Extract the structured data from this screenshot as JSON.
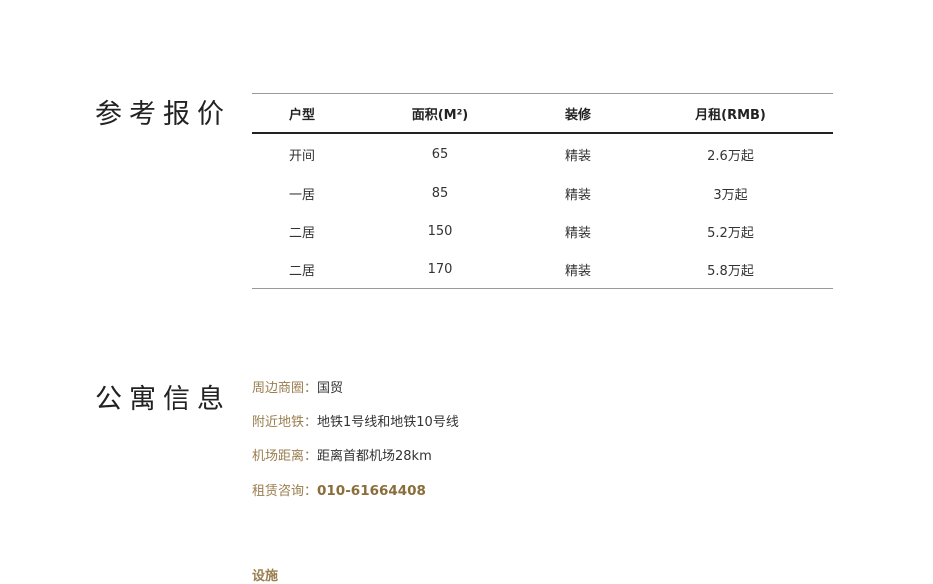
{
  "sections": {
    "price_title": "参考报价",
    "info_title": "公寓信息"
  },
  "price_table": {
    "headers": [
      "户型",
      "面积(M²)",
      "装修",
      "月租(RMB)"
    ],
    "rows": [
      [
        "开间",
        "65",
        "精装",
        "2.6万起"
      ],
      [
        "一居",
        "85",
        "精装",
        "3万起"
      ],
      [
        "二居",
        "150",
        "精装",
        "5.2万起"
      ],
      [
        "二居",
        "170",
        "精装",
        "5.8万起"
      ]
    ]
  },
  "info": [
    {
      "key": "周边商圈：",
      "value": "国贸"
    },
    {
      "key": "附近地铁：",
      "value": "地铁1号线和地铁10号线"
    },
    {
      "key": "机场距离：",
      "value": "距离首都机场28km"
    },
    {
      "key": "租赁咨询：",
      "value": "010-61664408"
    }
  ],
  "next_section_partial": "设施",
  "colors": {
    "label_gold": "#9a7e4f",
    "phone_gold": "#8a6d3b",
    "text_dark": "#222222"
  }
}
